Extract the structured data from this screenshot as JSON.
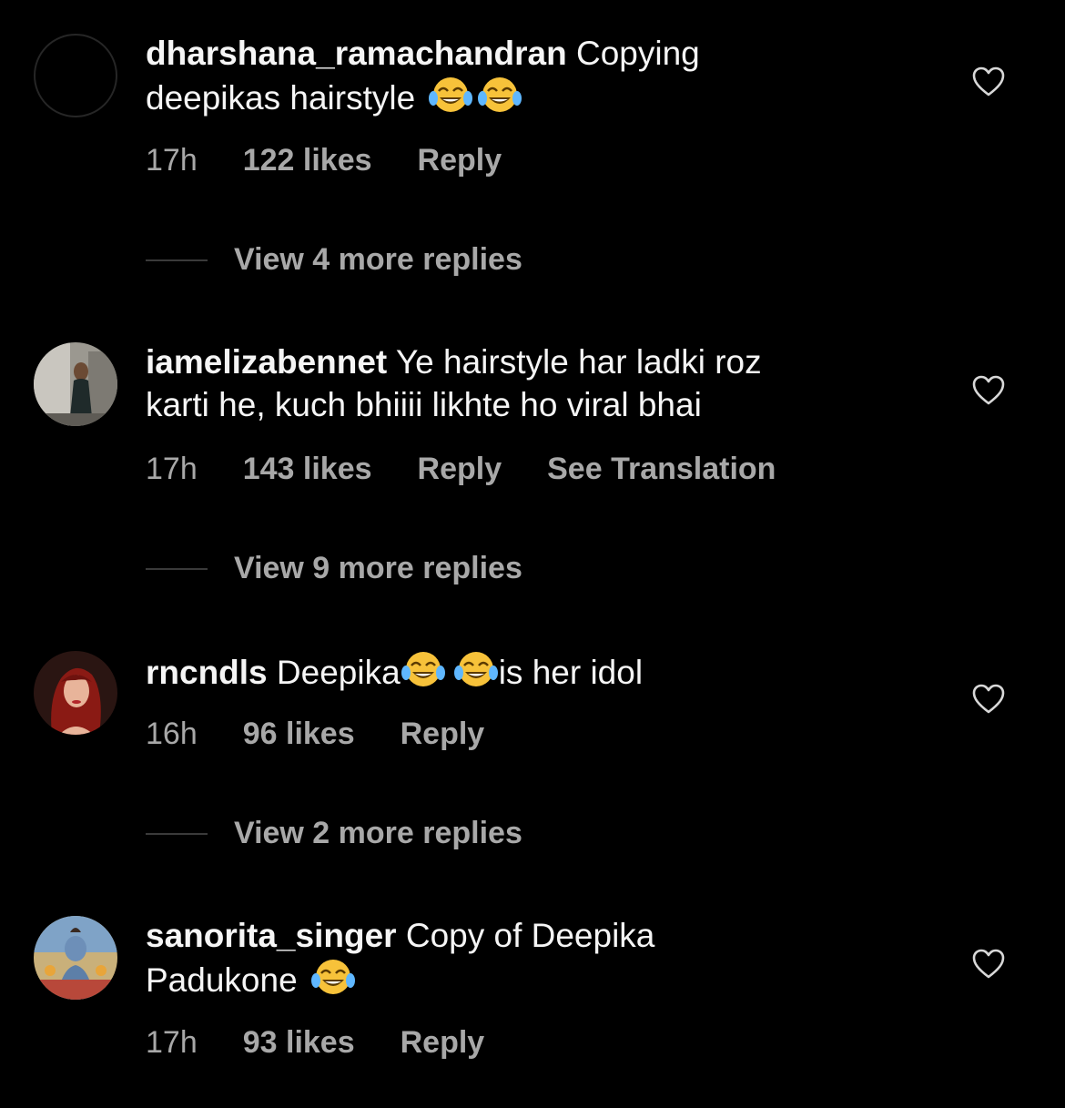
{
  "comments": [
    {
      "username": "dharshana_ramachandran",
      "text_line1": "Copying",
      "text_line2": "deepikas hairstyle",
      "time": "17h",
      "likes": "122 likes",
      "reply_label": "Reply",
      "view_replies": "View 4 more replies",
      "avatar_icon": "empty-avatar",
      "emojis": [
        "face-with-tears-of-joy",
        "face-with-tears-of-joy"
      ]
    },
    {
      "username": "iamelizabennet",
      "text_line1": "Ye hairstyle har ladki roz",
      "text_line2": "karti he, kuch bhiiii likhte ho viral bhai",
      "time": "17h",
      "likes": "143 likes",
      "reply_label": "Reply",
      "translate_label": "See Translation",
      "view_replies": "View 9 more replies",
      "avatar_icon": "photo-avatar"
    },
    {
      "username": "rncndls",
      "text_before": "Deepika",
      "text_after": "is her idol",
      "time": "16h",
      "likes": "96 likes",
      "reply_label": "Reply",
      "view_replies": "View 2 more replies",
      "avatar_icon": "photo-avatar",
      "emojis": [
        "face-with-tears-of-joy",
        "face-with-tears-of-joy"
      ]
    },
    {
      "username": "sanorita_singer",
      "text_line1": "Copy of Deepika",
      "text_line2": "Padukone",
      "time": "17h",
      "likes": "93 likes",
      "reply_label": "Reply",
      "avatar_icon": "photo-avatar",
      "emojis": [
        "face-with-tears-of-joy"
      ]
    }
  ],
  "colors": {
    "background": "#000000",
    "primary_text": "#f5f5f5",
    "secondary_text": "#a8a8a8",
    "emoji_yellow": "#f7c23a"
  },
  "icons": {
    "like": "heart-outline-icon"
  }
}
